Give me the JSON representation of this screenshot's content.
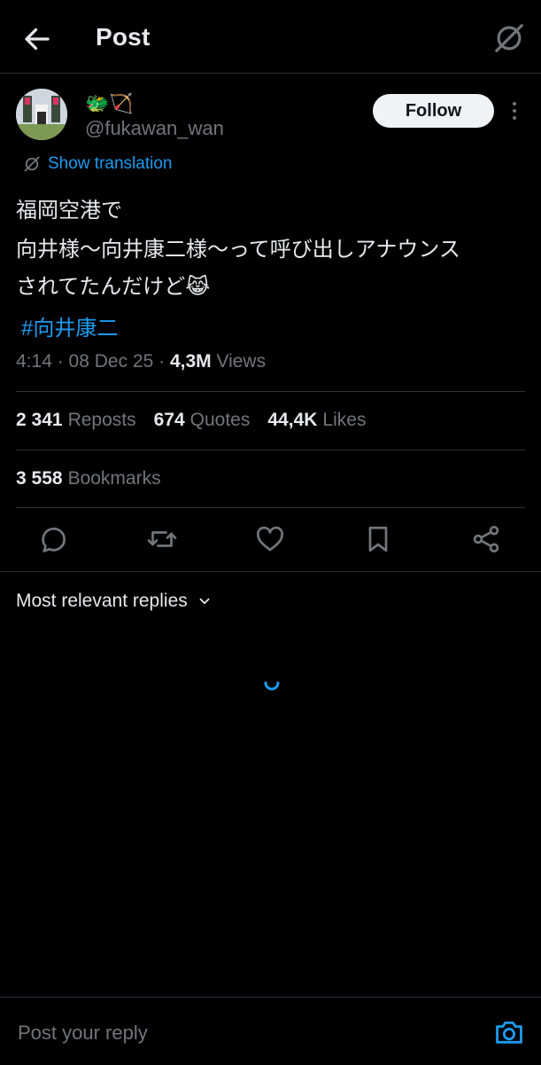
{
  "header": {
    "title": "Post",
    "back_icon": "arrow-left-icon",
    "grok_icon": "grok-icon"
  },
  "author": {
    "display_name": "🐲🏹",
    "handle": "@fukawan_wan",
    "follow_label": "Follow"
  },
  "translation": {
    "label": "Show translation"
  },
  "post": {
    "lines": [
      "福岡空港で",
      "向井様〜向井康二様〜って呼び出しアナウンス",
      "されてたんだけど😹"
    ],
    "hashtag": "#向井康二",
    "time_date": "4:14 · 08 Dec 25 · ",
    "views_count": "4,3M",
    "views_label": " Views"
  },
  "stats": {
    "reposts_count": "2 341",
    "reposts_label": "Reposts",
    "quotes_count": "674",
    "quotes_label": "Quotes",
    "likes_count": "44,4K",
    "likes_label": "Likes",
    "bookmarks_count": "3 558",
    "bookmarks_label": "Bookmarks"
  },
  "actions": [
    "reply-icon",
    "repost-icon",
    "like-icon",
    "bookmark-icon",
    "share-icon"
  ],
  "replies": {
    "sort_label": "Most relevant replies"
  },
  "composer": {
    "placeholder": "Post your reply"
  },
  "colors": {
    "background": "#000000",
    "text_primary": "#e7e9ea",
    "text_secondary": "#71767b",
    "accent": "#1d9bf0",
    "divider": "#2f3336",
    "follow_bg": "#eff3f4"
  }
}
